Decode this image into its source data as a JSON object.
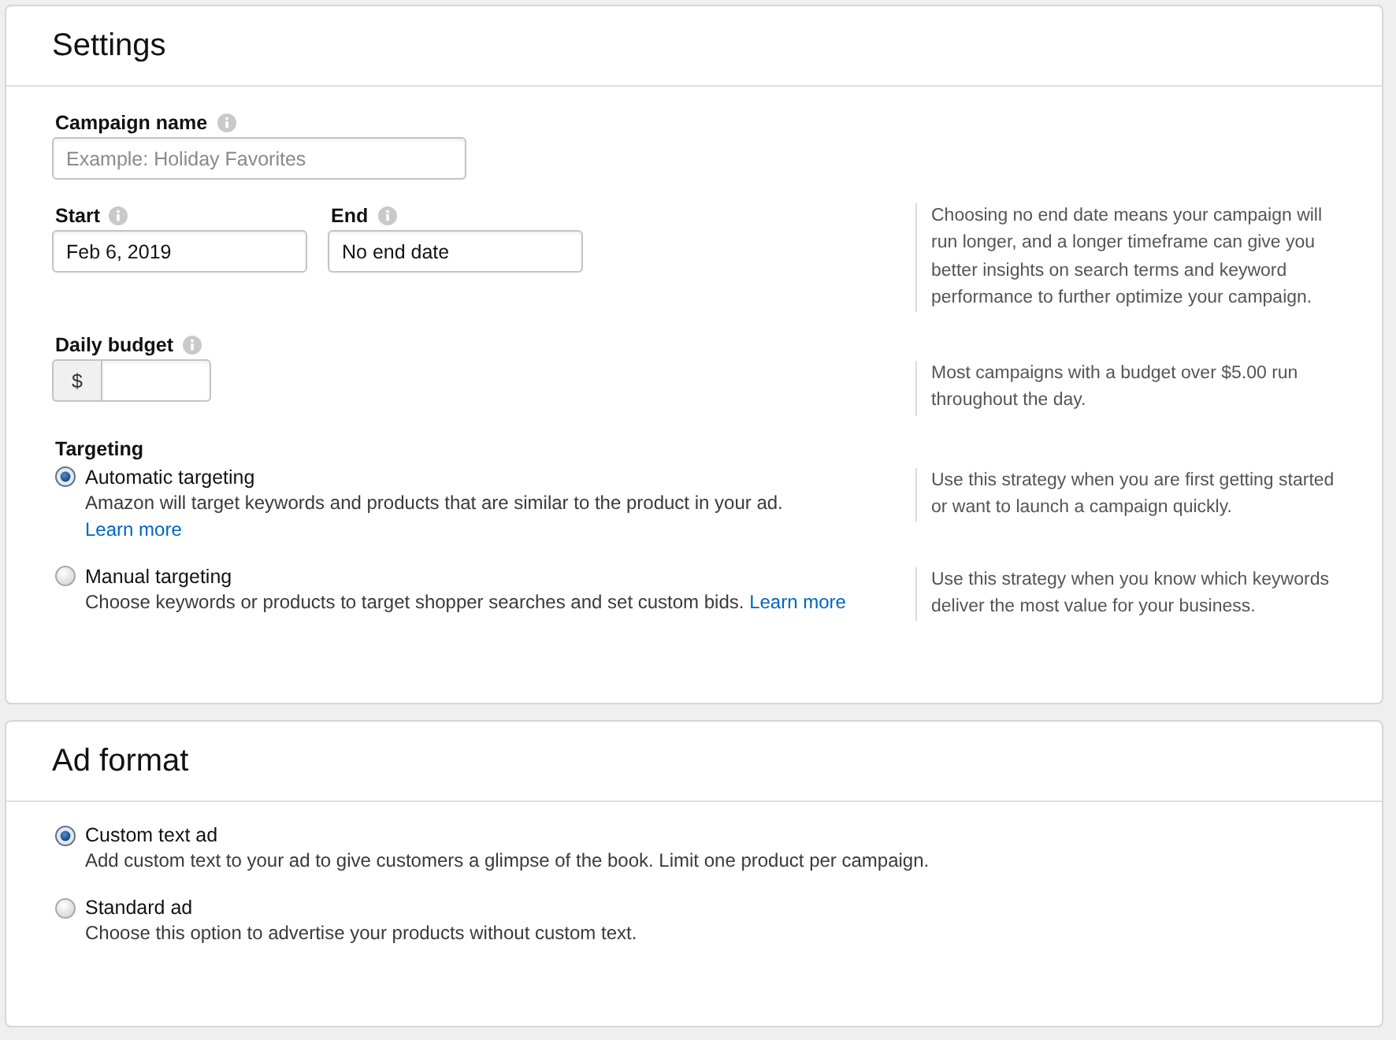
{
  "settings": {
    "title": "Settings",
    "campaign_name": {
      "label": "Campaign name",
      "placeholder": "Example: Holiday Favorites"
    },
    "dates": {
      "fields": [
        {
          "label": "Start",
          "value": "Feb 6, 2019"
        },
        {
          "label": "End",
          "value": "No end date"
        }
      ],
      "help": "Choosing no end date means your campaign will run longer, and a longer timeframe can give you better insights on search terms and keyword performance to further optimize your campaign."
    },
    "daily_budget": {
      "label": "Daily budget",
      "currency": "$",
      "help": "Most campaigns with a budget over $5.00 run throughout the day."
    },
    "targeting": {
      "label": "Targeting",
      "options": [
        {
          "label": "Automatic targeting",
          "selected": true,
          "description": "Amazon will target keywords and products that are similar to the product in your ad.",
          "link": "Learn more",
          "help": "Use this strategy when you are first getting started or want to launch a campaign quickly."
        },
        {
          "label": "Manual targeting",
          "selected": false,
          "description": "Choose keywords or products to target shopper searches and set custom bids.",
          "link": "Learn more",
          "help": "Use this strategy when you know which keywords deliver the most value for your business."
        }
      ]
    }
  },
  "ad_format": {
    "title": "Ad format",
    "options": [
      {
        "label": "Custom text ad",
        "selected": true,
        "description": "Add custom text to your ad to give customers a glimpse of the book. Limit one product per campaign."
      },
      {
        "label": "Standard ad",
        "selected": false,
        "description": "Choose this option to advertise your products without custom text."
      }
    ]
  }
}
